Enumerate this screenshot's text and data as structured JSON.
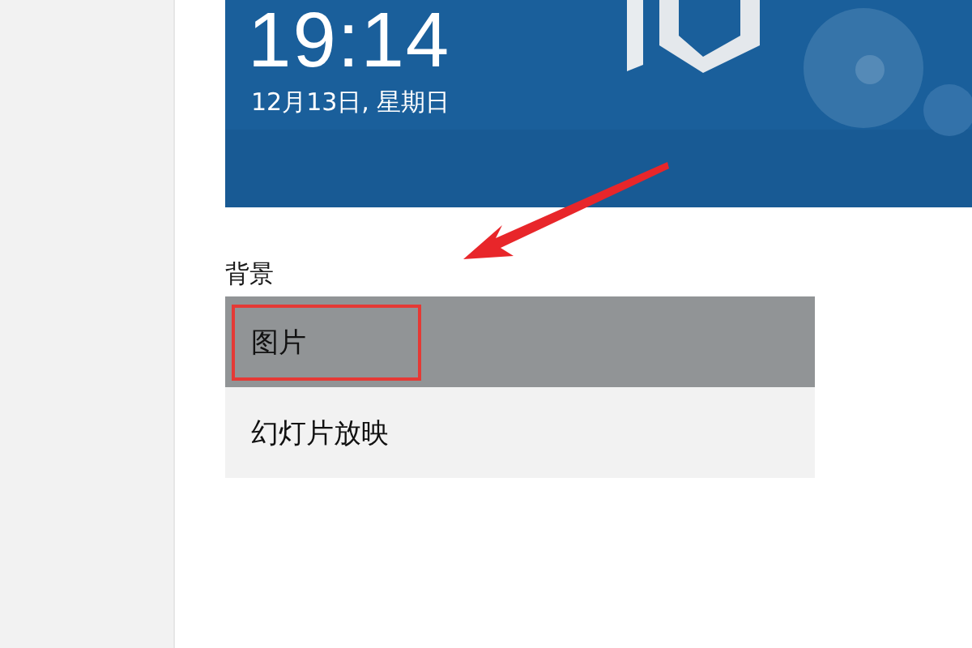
{
  "lock_screen_preview": {
    "time": "19:14",
    "date": "12月13日, 星期日"
  },
  "background": {
    "label": "背景",
    "options": [
      {
        "label": "图片",
        "selected": true,
        "highlighted": true
      },
      {
        "label": "幻灯片放映",
        "selected": false,
        "highlighted": false
      }
    ]
  },
  "annotation": {
    "arrow": true
  }
}
